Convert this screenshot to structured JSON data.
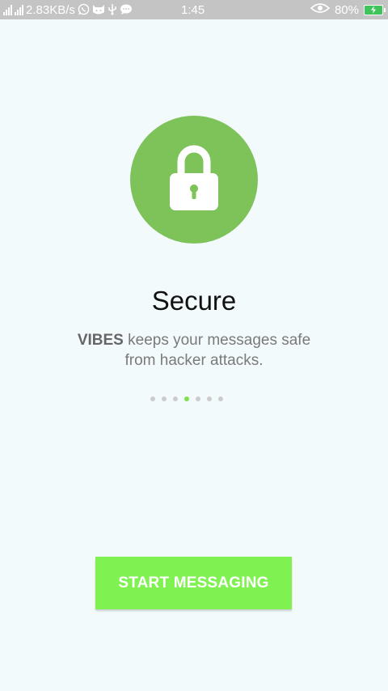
{
  "status_bar": {
    "network_speed": "2.83KB/s",
    "time": "1:45",
    "battery": "80%",
    "icons": [
      "signal-icon",
      "whatsapp-icon",
      "cat-icon",
      "usb-icon",
      "chat-icon",
      "eye-icon",
      "battery-charging-icon"
    ]
  },
  "onboarding": {
    "icon": "lock-icon",
    "title": "Secure",
    "brand": "VIBES",
    "description_rest": " keeps your messages safe from hacker attacks.",
    "page_count": 7,
    "active_page": 4
  },
  "cta": {
    "label": "START MESSAGING"
  },
  "colors": {
    "background": "#f3fafb",
    "status_bar": "#c4c4c4",
    "hero_circle": "#7dc35a",
    "button": "#7ff251",
    "dot_active": "#7fe04c",
    "dot_inactive": "#cccccc"
  }
}
